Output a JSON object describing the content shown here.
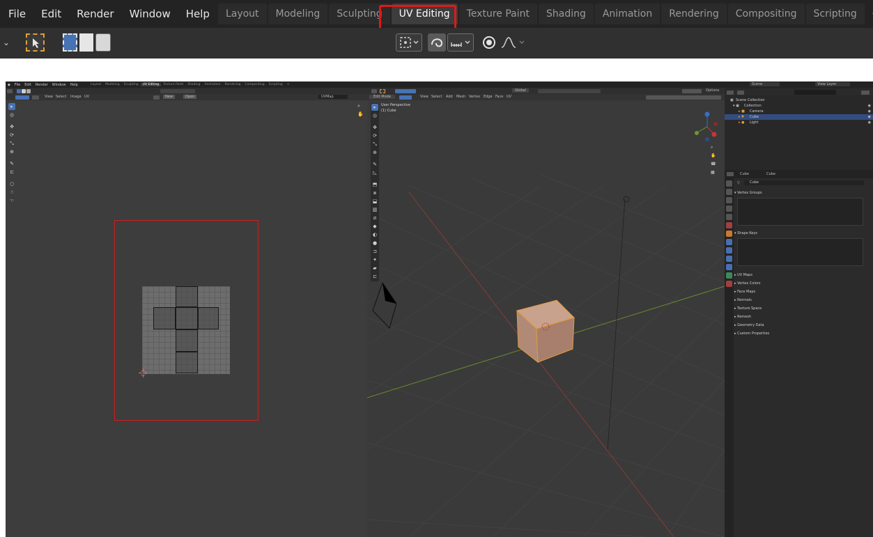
{
  "zoom": {
    "menus": [
      "File",
      "Edit",
      "Render",
      "Window",
      "Help"
    ],
    "tabs": [
      {
        "label": "Layout",
        "active": false
      },
      {
        "label": "Modeling",
        "active": false
      },
      {
        "label": "Sculpting",
        "active": false
      },
      {
        "label": "UV Editing",
        "active": true
      },
      {
        "label": "Texture Paint",
        "active": false
      },
      {
        "label": "Shading",
        "active": false
      },
      {
        "label": "Animation",
        "active": false
      },
      {
        "label": "Rendering",
        "active": false
      },
      {
        "label": "Compositing",
        "active": false
      },
      {
        "label": "Scripting",
        "active": false
      }
    ],
    "plus": "+",
    "highlight_color": "#e11818"
  },
  "blender": {
    "menus": [
      "File",
      "Edit",
      "Render",
      "Window",
      "Help"
    ],
    "tabs": [
      "Layout",
      "Modeling",
      "Sculpting",
      "UV Editing",
      "Texture Paint",
      "Shading",
      "Animation",
      "Rendering",
      "Compositing",
      "Scripting",
      "+"
    ],
    "active_tab": "UV Editing",
    "uv_editor": {
      "menus": [
        "View",
        "Select",
        "Image",
        "UV"
      ],
      "new_label": "New",
      "open_label": "Open",
      "uvmap_label": "UVMap"
    },
    "viewport": {
      "mode_label": "Edit Mode",
      "menus": [
        "View",
        "Select",
        "Add",
        "Mesh",
        "Vertex",
        "Edge",
        "Face",
        "UV"
      ],
      "transform_orientation": "Global",
      "options_label": "Options",
      "perspective_label": "User Perspective",
      "object_label": "(1) Cube"
    },
    "outliner": {
      "scene_label": "Scene",
      "view_layer_label": "View Layer",
      "items": [
        {
          "label": "Scene Collection"
        },
        {
          "label": "Collection"
        },
        {
          "label": "Camera"
        },
        {
          "label": "Cube"
        },
        {
          "label": "Light"
        }
      ]
    },
    "properties": {
      "object_name": "Cube",
      "data_name": "Cube",
      "mesh_field": "Cube",
      "panels": [
        "Vertex Groups",
        "Shape Keys",
        "UV Maps",
        "Vertex Colors",
        "Face Maps",
        "Normals",
        "Texture Space",
        "Remesh",
        "Geometry Data",
        "Custom Properties"
      ]
    },
    "colors": {
      "accent_blue": "#4772b3",
      "selection_orange": "#e3a035",
      "annotation_red": "#d21d1d"
    }
  }
}
